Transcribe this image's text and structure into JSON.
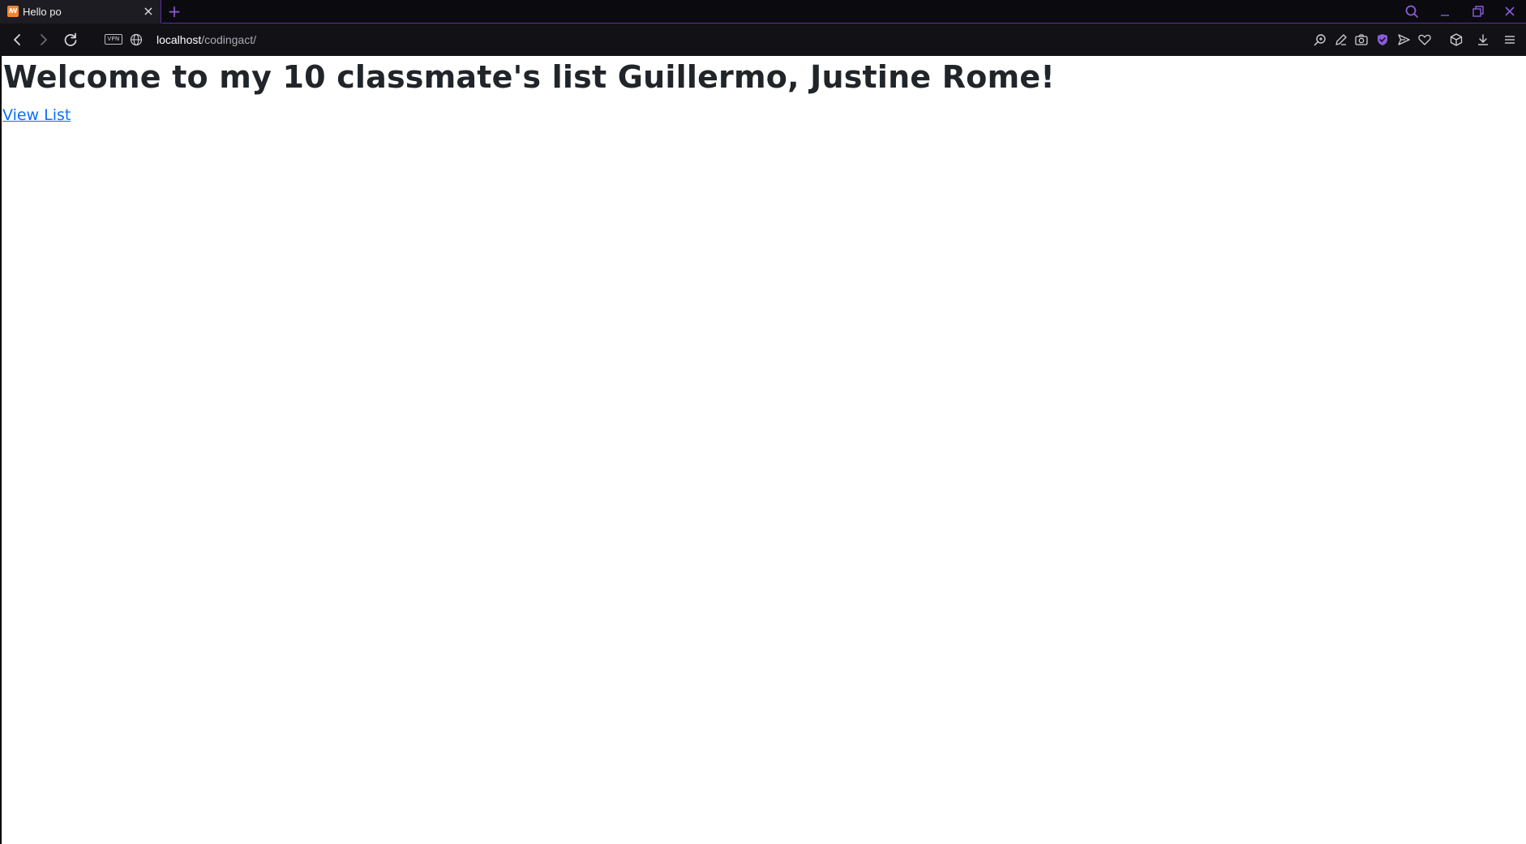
{
  "browser": {
    "tab": {
      "title": "Hello po",
      "favicon": "xampp-favicon-icon"
    },
    "new_tab_symbol": "+",
    "close_symbol": "×",
    "address": {
      "vpn_label": "VPN",
      "host": "localhost",
      "path": "/codingact/"
    },
    "accent_color": "#8a5cd8"
  },
  "page": {
    "heading": "Welcome to my 10 classmate's list Guillermo, Justine Rome!",
    "link_label": "View List",
    "text_color": "#212529",
    "link_color": "#0d6efd"
  }
}
